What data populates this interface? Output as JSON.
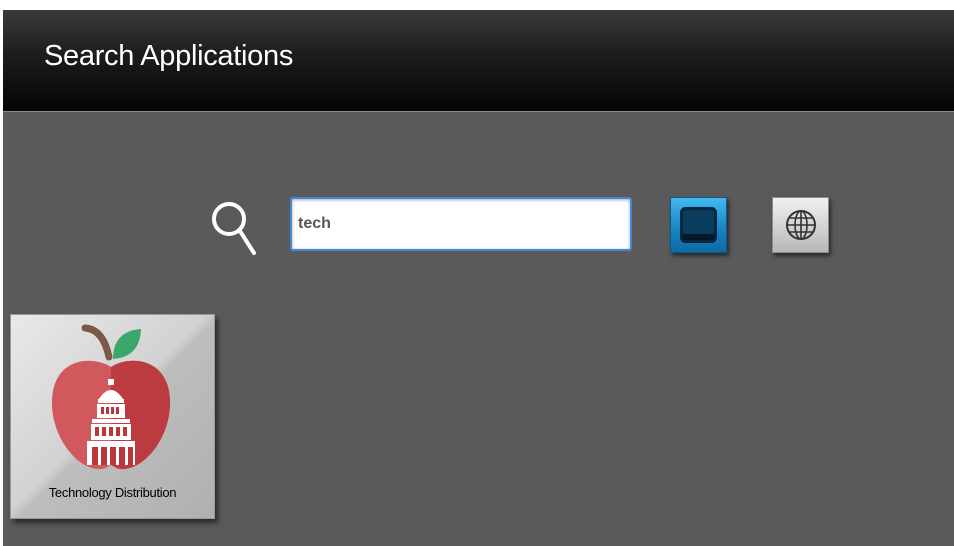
{
  "header": {
    "title": "Search Applications"
  },
  "search": {
    "value": "tech",
    "icon": "magnifier-icon"
  },
  "filters": [
    {
      "id": "desktop",
      "icon": "desktop-monitor-icon",
      "selected": true
    },
    {
      "id": "web",
      "icon": "globe-icon",
      "selected": false
    }
  ],
  "results": [
    {
      "label": "Technology Distribution",
      "icon": "apple-capitol-logo"
    }
  ],
  "colors": {
    "header_bg": "#050505",
    "body_bg": "#5a5a5a",
    "accent_blue": "#1a86c5",
    "apple_red": "#c63a3f",
    "leaf_green": "#3aa86b"
  }
}
